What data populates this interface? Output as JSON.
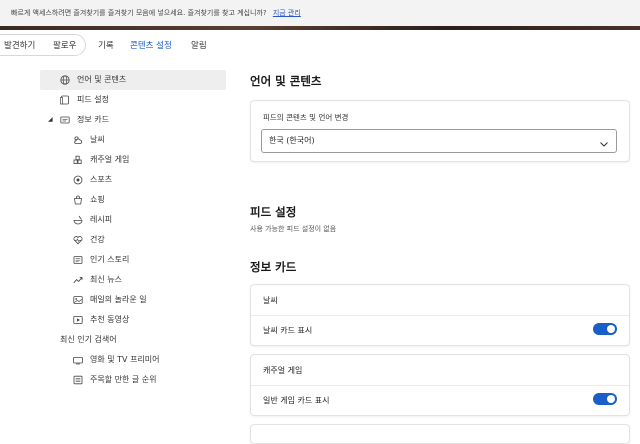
{
  "banner": {
    "text": "빠르게 액세스하려면 즐겨찾기를 즐겨찾기 모음에 넣으세요. 즐겨찾기를 찾고 계십니까?",
    "link": "지금 관리"
  },
  "topnav": {
    "items": [
      {
        "label": "발견하기",
        "active": false
      },
      {
        "label": "팔로우",
        "active": false
      },
      {
        "label": "기록",
        "active": false
      },
      {
        "label": "콘텐츠 설정",
        "active": true
      },
      {
        "label": "알림",
        "active": false
      }
    ]
  },
  "sidebar": {
    "items": [
      {
        "label": "언어 및 콘텐츠",
        "icon": "globe-icon",
        "selected": true
      },
      {
        "label": "피드 설정",
        "icon": "feed-icon"
      },
      {
        "label": "정보 카드",
        "icon": "card-icon",
        "expanded": true
      },
      {
        "label": "날씨",
        "icon": "weather-icon"
      },
      {
        "label": "캐주얼 게임",
        "icon": "game-icon"
      },
      {
        "label": "스포츠",
        "icon": "sports-icon"
      },
      {
        "label": "쇼핑",
        "icon": "shopping-icon"
      },
      {
        "label": "레시피",
        "icon": "recipe-icon"
      },
      {
        "label": "건강",
        "icon": "health-icon"
      },
      {
        "label": "인기 스토리",
        "icon": "story-icon"
      },
      {
        "label": "최신 뉴스",
        "icon": "trending-icon"
      },
      {
        "label": "매일의 놀라운 일",
        "icon": "image-icon"
      },
      {
        "label": "추천 동영상",
        "icon": "video-icon"
      },
      {
        "label": "최신 인기 검색어",
        "icon": ""
      },
      {
        "label": "영화 및 TV 프리미어",
        "icon": "tv-icon"
      },
      {
        "label": "주목할 만한 글 순위",
        "icon": "list-icon"
      }
    ]
  },
  "main": {
    "lang_section": {
      "title": "언어 및 콘텐츠",
      "field_label": "피드의 콘텐츠 및 언어 변경",
      "selected_value": "한국 (한국어)"
    },
    "feed_section": {
      "title": "피드 설정",
      "note": "사용 가능한 피드 설정이 없음"
    },
    "info_section": {
      "title": "정보 카드",
      "cards": [
        {
          "title": "날씨",
          "row_label": "날씨 카드 표시",
          "enabled": true
        },
        {
          "title": "캐주얼 게임",
          "row_label": "일반 게임 카드 표시",
          "enabled": true
        }
      ]
    }
  },
  "colors": {
    "accent": "#1a5fc8",
    "banner_bg": "#f3f3f3",
    "selected_bg": "#eeeeee"
  }
}
